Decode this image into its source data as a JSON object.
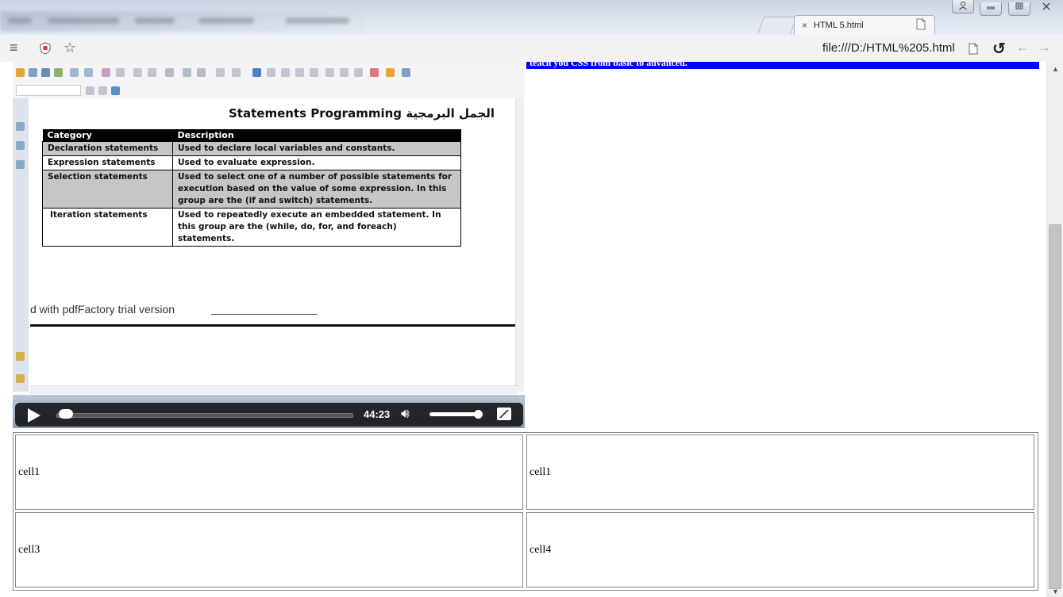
{
  "browser": {
    "tab_close_glyph": "×",
    "tab_title": "HTML 5.html",
    "address": "file:///D:/HTML%205.html",
    "window_controls": [
      "person-icon",
      "minimize-icon",
      "maximize-icon",
      "close-icon"
    ]
  },
  "page": {
    "blue_banner_text": "teach you CSS from basic to advanced.",
    "accent_color": "#0000ff"
  },
  "video": {
    "document": {
      "title": "Statements Programming  الجمل البرمجية",
      "table": {
        "headers": [
          "Category",
          "Description"
        ],
        "rows": [
          {
            "category": "Declaration statements",
            "description": "Used to declare local variables and constants."
          },
          {
            "category": "Expression statements",
            "description": "Used to evaluate expression."
          },
          {
            "category": "Selection statements",
            "description": "Used to select one of a number of possible statements for execution based on the value of some expression. In this group are the (if and switch) statements."
          },
          {
            "category": "Iteration statements",
            "description": "Used to repeatedly execute an embedded statement. In this group are the (while, do, for, and foreach) statements."
          }
        ]
      },
      "footer_text": "d with pdfFactory trial version"
    },
    "player": {
      "time": "44:23",
      "progress_fraction": 0.02,
      "volume_fraction": 0.9
    }
  },
  "cells": [
    [
      "cell1",
      "cell1"
    ],
    [
      "cell3",
      "cell4"
    ]
  ]
}
